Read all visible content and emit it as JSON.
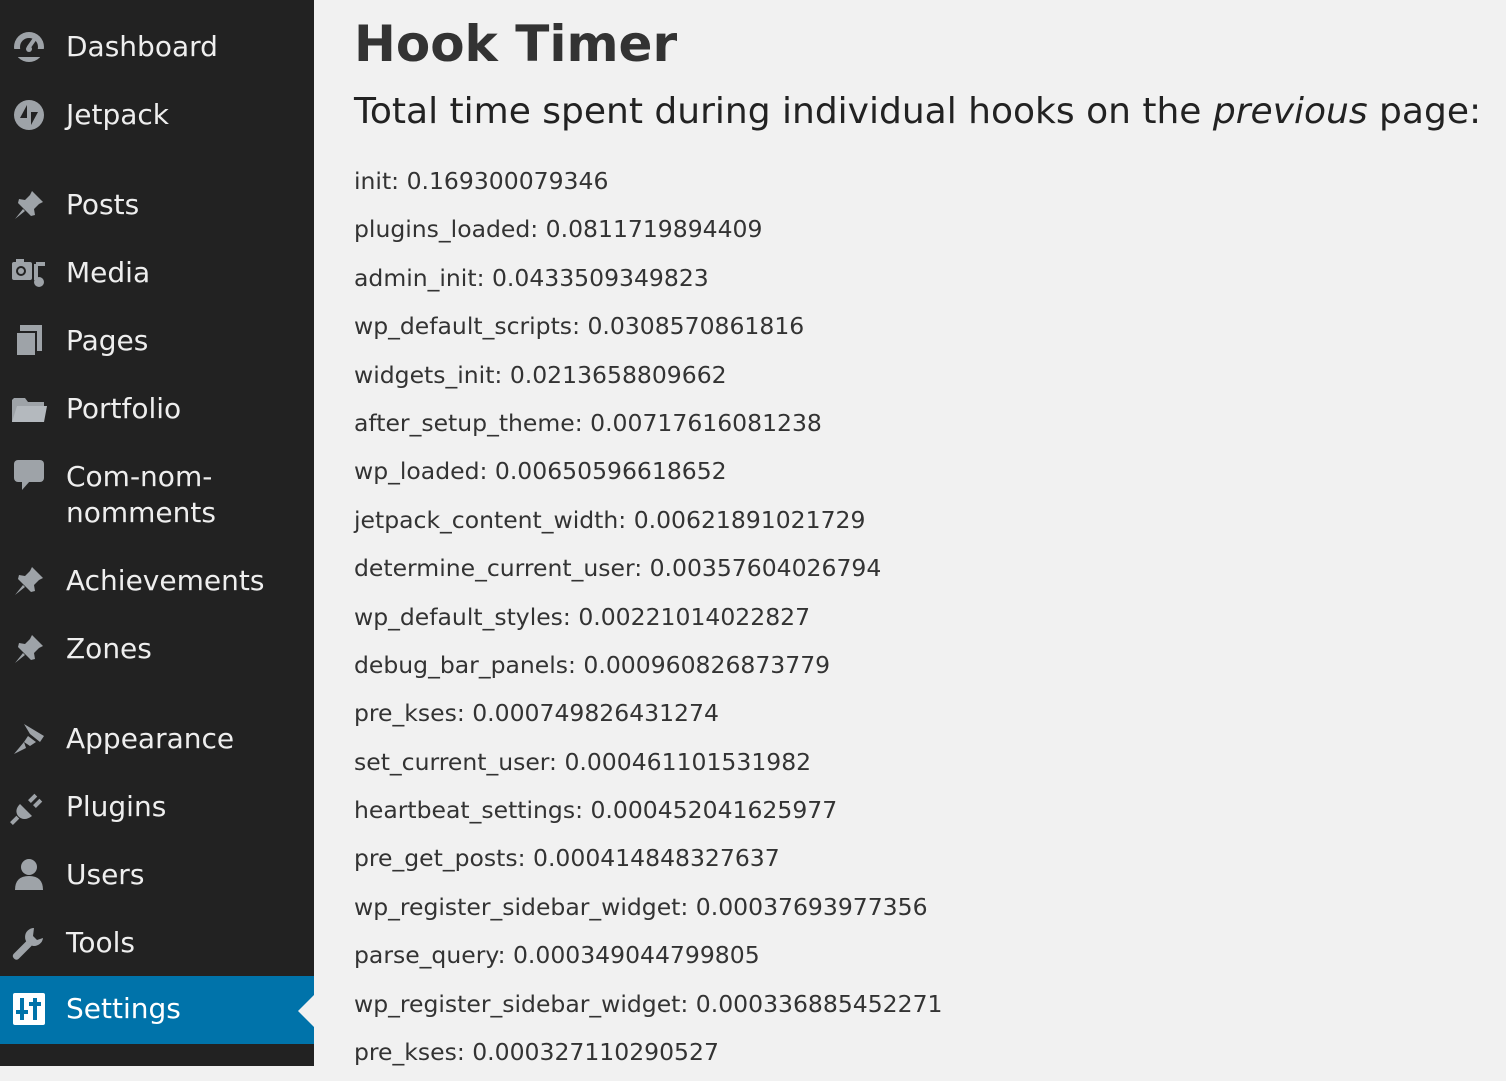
{
  "sidebar": {
    "items": [
      {
        "label": "Dashboard",
        "icon": "dashboard-icon"
      },
      {
        "label": "Jetpack",
        "icon": "jetpack-icon"
      },
      {
        "label": "Posts",
        "icon": "pushpin-icon"
      },
      {
        "label": "Media",
        "icon": "media-icon"
      },
      {
        "label": "Pages",
        "icon": "pages-icon"
      },
      {
        "label": "Portfolio",
        "icon": "folder-icon"
      },
      {
        "label": "Com-nom-\nnomments",
        "icon": "comment-icon"
      },
      {
        "label": "Achievements",
        "icon": "pushpin-icon"
      },
      {
        "label": "Zones",
        "icon": "pushpin-icon"
      },
      {
        "label": "Appearance",
        "icon": "paintbrush-icon"
      },
      {
        "label": "Plugins",
        "icon": "plug-icon"
      },
      {
        "label": "Users",
        "icon": "user-icon"
      },
      {
        "label": "Tools",
        "icon": "wrench-icon"
      },
      {
        "label": "Settings",
        "icon": "settings-sliders-icon",
        "current": true
      }
    ],
    "colors": {
      "background": "#222222",
      "current": "#0073aa",
      "text": "#eeeeee"
    }
  },
  "main": {
    "title": "Hook Timer",
    "subtitle_before": "Total time spent during individual hooks on the ",
    "subtitle_emphasis": "previous",
    "subtitle_after": " page:",
    "hooks": [
      {
        "name": "init",
        "time": "0.169300079346"
      },
      {
        "name": "plugins_loaded",
        "time": "0.0811719894409"
      },
      {
        "name": "admin_init",
        "time": "0.0433509349823"
      },
      {
        "name": "wp_default_scripts",
        "time": "0.0308570861816"
      },
      {
        "name": "widgets_init",
        "time": "0.0213658809662"
      },
      {
        "name": "after_setup_theme",
        "time": "0.00717616081238"
      },
      {
        "name": "wp_loaded",
        "time": "0.00650596618652"
      },
      {
        "name": "jetpack_content_width",
        "time": "0.00621891021729"
      },
      {
        "name": "determine_current_user",
        "time": "0.00357604026794"
      },
      {
        "name": "wp_default_styles",
        "time": "0.00221014022827"
      },
      {
        "name": "debug_bar_panels",
        "time": "0.000960826873779"
      },
      {
        "name": "pre_kses",
        "time": "0.000749826431274"
      },
      {
        "name": "set_current_user",
        "time": "0.000461101531982"
      },
      {
        "name": "heartbeat_settings",
        "time": "0.000452041625977"
      },
      {
        "name": "pre_get_posts",
        "time": "0.000414848327637"
      },
      {
        "name": "wp_register_sidebar_widget",
        "time": "0.00037693977356"
      },
      {
        "name": "parse_query",
        "time": "0.000349044799805"
      },
      {
        "name": "wp_register_sidebar_widget",
        "time": "0.000336885452271"
      },
      {
        "name": "pre_kses",
        "time": "0.000327110290527"
      }
    ]
  }
}
